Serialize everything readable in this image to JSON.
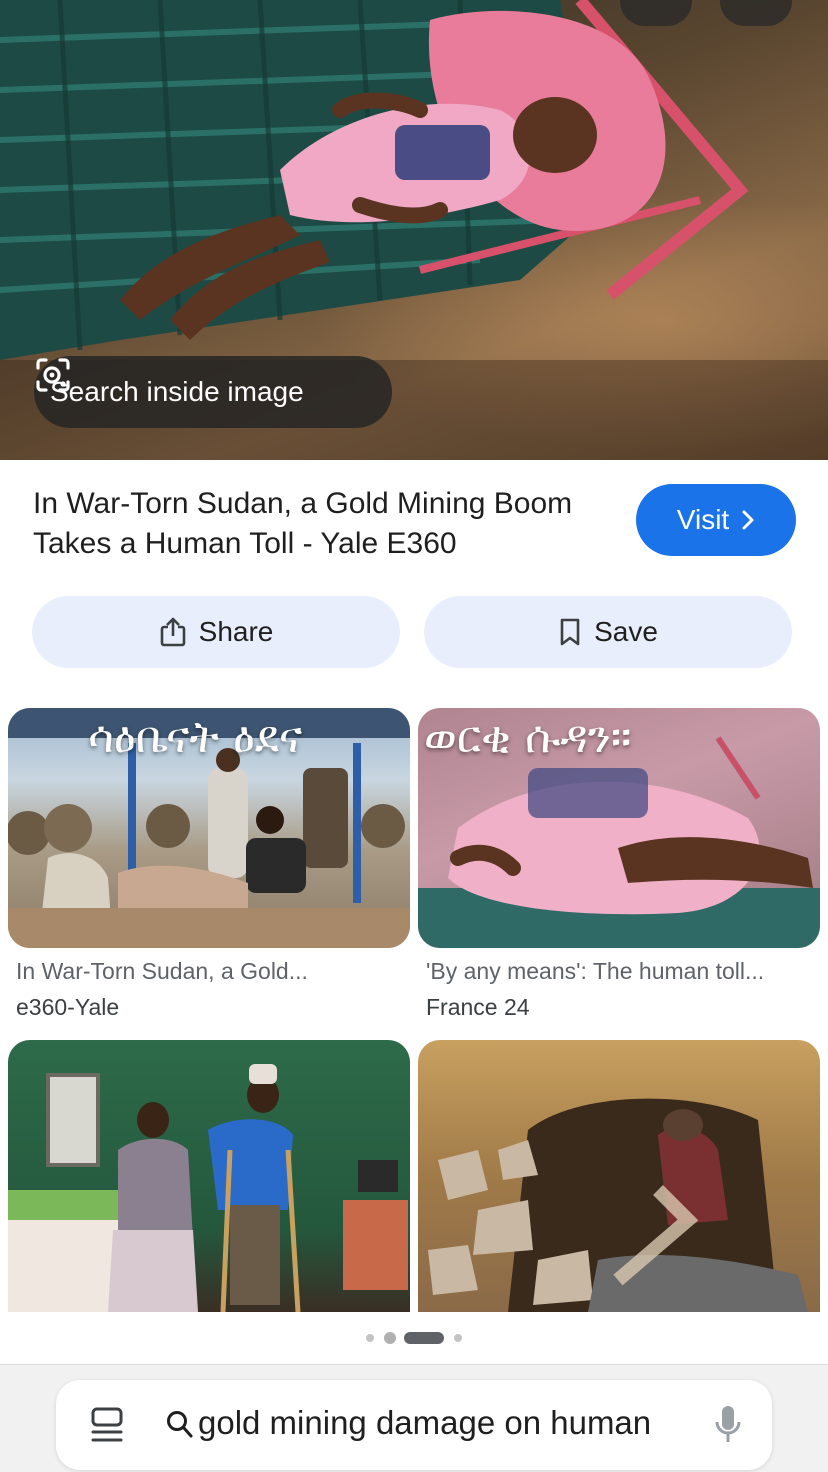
{
  "hero": {
    "search_inside_label": "Search inside image"
  },
  "result": {
    "title": "In War-Torn Sudan, a Gold Mining Boom Takes a Human Toll - Yale E360",
    "visit_label": "Visit",
    "share_label": "Share",
    "save_label": "Save"
  },
  "related": [
    {
      "overlay_text": "ሳዕቤናት ዕደና",
      "title": "In War-Torn Sudan, a Gold...",
      "source": "e360-Yale"
    },
    {
      "overlay_text": "ወርቂ ሱዳን።",
      "title": "'By any means': The human toll...",
      "source": "France 24"
    },
    {
      "title": "",
      "source": ""
    },
    {
      "title": "",
      "source": ""
    }
  ],
  "pagination": {
    "total": 4,
    "active_index": 2
  },
  "search_bar": {
    "query": "gold mining damage on human"
  },
  "colors": {
    "accent": "#1a73e8",
    "pill_bg": "#e8eefc",
    "muted_text": "#5f6368"
  },
  "icons": [
    "lens-icon",
    "chevron-right-icon",
    "share-icon",
    "bookmark-icon",
    "tabs-icon",
    "search-icon",
    "mic-icon"
  ]
}
